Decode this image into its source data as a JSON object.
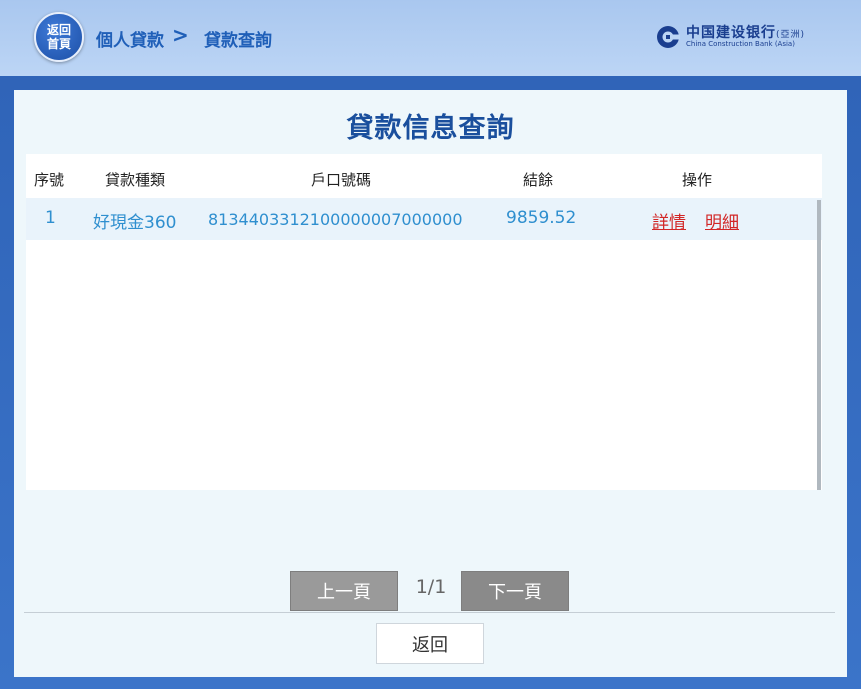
{
  "header": {
    "home_button": "返回首頁",
    "breadcrumb": [
      "個人貸款",
      "貸款查詢"
    ],
    "breadcrumb_separator": ">",
    "logo_cn": "中国建设银行",
    "logo_cn_suffix": "(亞洲)",
    "logo_en": "China Construction Bank (Asia)"
  },
  "main": {
    "title": "貸款信息查詢",
    "columns": [
      "序號",
      "貸款種類",
      "戶口號碼",
      "結餘",
      "操作"
    ],
    "rows": [
      {
        "index": "1",
        "loan_type": "好現金360",
        "account": "8134403312100000007000000",
        "balance": "9859.52",
        "actions": [
          "詳情",
          "明細"
        ]
      }
    ]
  },
  "pager": {
    "prev_label": "上一頁",
    "page_info": "1/1",
    "next_label": "下一頁"
  },
  "footer": {
    "back_label": "返回"
  },
  "colors": {
    "brand_blue": "#1a4f9d",
    "link_red": "#d22626",
    "value_blue": "#2f8fcf",
    "pager_gray": "#9a9a9a"
  },
  "icons": [
    "home-icon",
    "ccb-logo-icon"
  ]
}
